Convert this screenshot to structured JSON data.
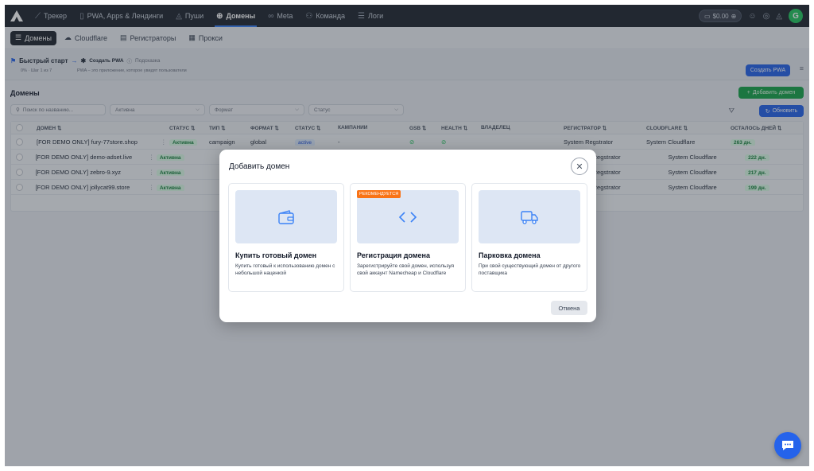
{
  "nav": {
    "items": [
      {
        "label": "Трекер",
        "icon": "chart-line-icon"
      },
      {
        "label": "PWA, Apps & Лендинги",
        "icon": "phone-icon"
      },
      {
        "label": "Пуши",
        "icon": "bell-icon"
      },
      {
        "label": "Домены",
        "icon": "globe-icon",
        "active": true
      },
      {
        "label": "Meta",
        "icon": "infinity-icon"
      },
      {
        "label": "Команда",
        "icon": "users-icon"
      },
      {
        "label": "Логи",
        "icon": "list-icon"
      }
    ],
    "balance": "$0.00",
    "avatar_letter": "G"
  },
  "subnav": {
    "items": [
      {
        "label": "Домены",
        "icon": "list-icon",
        "active": true
      },
      {
        "label": "Cloudflare",
        "icon": "cloud-icon"
      },
      {
        "label": "Регистраторы",
        "icon": "server-icon"
      },
      {
        "label": "Прокси",
        "icon": "table-icon"
      }
    ]
  },
  "quickstart": {
    "title": "Быстрый старт",
    "progress_text": "0% · Шаг 1 из 7",
    "step": "Создать PWA",
    "hint_label": "Подсказка",
    "hint_text": "PWA – это приложение, которое увидят пользователи",
    "create_button": "Создать PWA"
  },
  "section": {
    "title": "Домены",
    "add_button": "Добавить домен",
    "refresh_button": "Обновить",
    "filters": {
      "search_placeholder": "Поиск по названию...",
      "status_value": "Активна",
      "format_placeholder": "Формат",
      "status2_placeholder": "Статус"
    }
  },
  "table": {
    "headers": [
      "ДОМЕН",
      "СТАТУС",
      "ТИП",
      "ФОРМАТ",
      "СТАТУС",
      "КАМПАНИИ",
      "GSB",
      "HEALTH",
      "ВЛАДЕЛЕЦ",
      "РЕГИСТРАТОР",
      "CLOUDFLARE",
      "ОСТАЛОСЬ ДНЕЙ"
    ],
    "rows": [
      {
        "domain": "[FOR DEMO ONLY] fury-77store.shop",
        "status": "Активна",
        "type": "campaign",
        "format": "global",
        "status2": "active",
        "campaigns": "-",
        "registrar": "System Regstrator",
        "cloudflare": "System Cloudflare",
        "days": "263 дн."
      },
      {
        "domain": "[FOR DEMO ONLY] demo-adset.live",
        "status": "Активна",
        "type": "",
        "format": "",
        "status2": "",
        "campaigns": "",
        "registrar": "Regstrator",
        "cloudflare": "System Cloudflare",
        "days": "222 дн."
      },
      {
        "domain": "[FOR DEMO ONLY] zebro-9.xyz",
        "status": "Активна",
        "type": "",
        "format": "",
        "status2": "",
        "campaigns": "",
        "registrar": "Regstrator",
        "cloudflare": "System Cloudflare",
        "days": "217 дн."
      },
      {
        "domain": "[FOR DEMO ONLY] jollycat99.store",
        "status": "Активна",
        "type": "",
        "format": "",
        "status2": "",
        "campaigns": "",
        "registrar": "Regstrator",
        "cloudflare": "System Cloudflare",
        "days": "199 дн."
      }
    ]
  },
  "modal": {
    "title": "Добавить домен",
    "cards": [
      {
        "title": "Купить готовый домен",
        "desc": "Купить готовый к использованию домен с небольшой наценкой",
        "icon": "wallet-icon"
      },
      {
        "title": "Регистрация домена",
        "desc": "Зарегистрируйте свой домен, используя свой аккаунт Namecheap и Cloudflare",
        "icon": "code-icon",
        "badge": "РЕКОМЕНДУЕТСЯ"
      },
      {
        "title": "Парковка домена",
        "desc": "При свой существующий домен от другого поставщика",
        "icon": "truck-icon"
      }
    ],
    "cancel": "Отмена"
  },
  "colors": {
    "accent": "#2563eb",
    "success": "#16a34a",
    "nav_bg": "#1f2630",
    "recommended": "#f97316"
  }
}
